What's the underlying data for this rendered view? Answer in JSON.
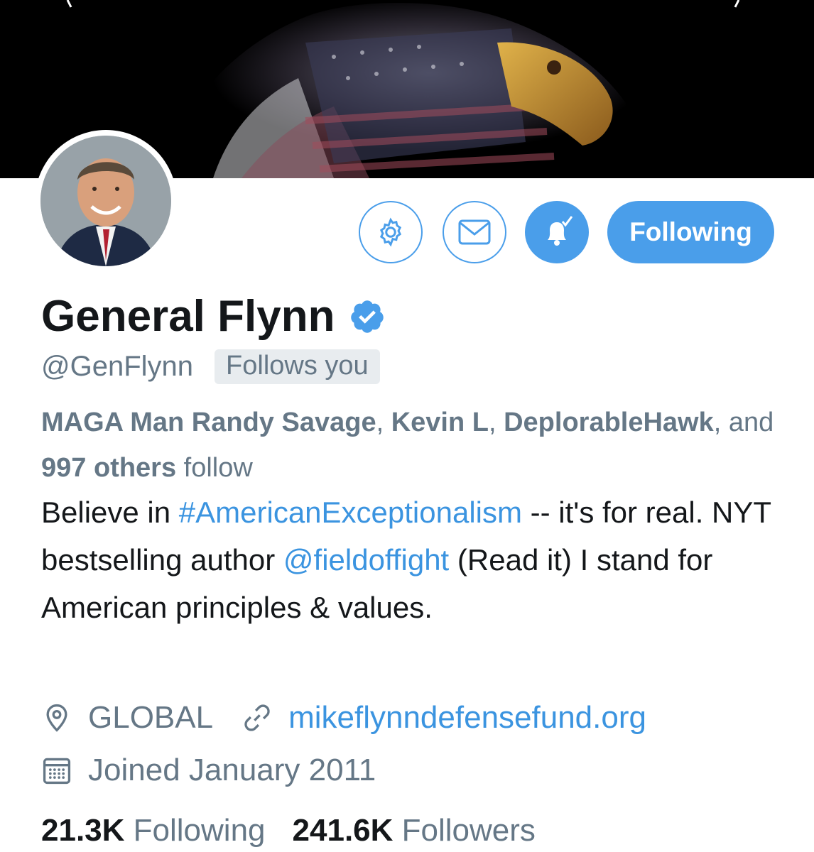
{
  "profile": {
    "display_name": "General Flynn",
    "handle": "@GenFlynn",
    "follows_you_badge": "Follows you",
    "verified": true
  },
  "actions": {
    "settings_icon": "gear-icon",
    "message_icon": "envelope-icon",
    "notify_icon": "bell-check-icon",
    "following_label": "Following"
  },
  "followed_by": {
    "name1": "MAGA Man Randy Savage",
    "sep1": ", ",
    "name2": "Kevin L",
    "sep2": ",",
    "name3": "DeplorableHawk",
    "sep3": ", and ",
    "others": "997 others",
    "suffix": " follow"
  },
  "bio": {
    "part1": "Believe in ",
    "hashtag": "#AmericanExceptionalism",
    "part2": " -- it's for real. NYT bestselling author ",
    "mention": "@fieldoffight",
    "part3": " (Read it) I stand for American principles & values."
  },
  "meta": {
    "location": "GLOBAL",
    "website": "mikeflynndefensefund.org",
    "joined": "Joined January 2011"
  },
  "stats": {
    "following_count": "21.3K",
    "following_label": "Following",
    "followers_count": "241.6K",
    "followers_label": "Followers"
  },
  "colors": {
    "accent": "#4a9eea",
    "link": "#3b94e0",
    "secondary_text": "#657786",
    "badge_bg": "#e8ecef"
  }
}
